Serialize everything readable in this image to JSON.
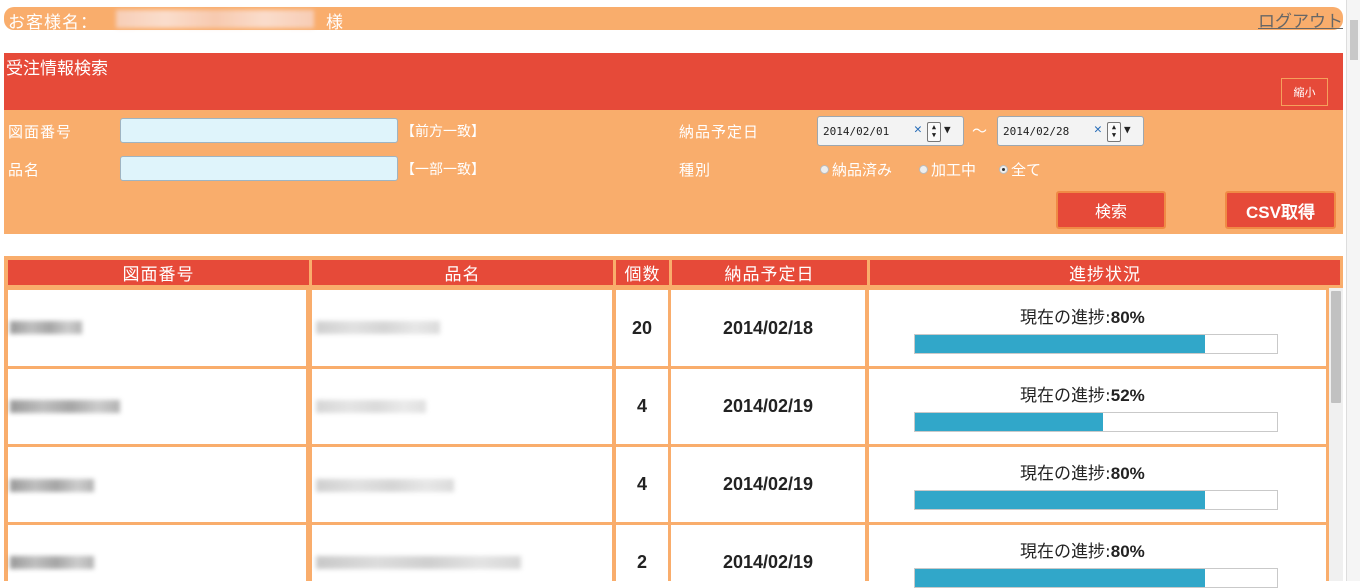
{
  "header": {
    "customer_label": "お客様名：",
    "honorific": "様",
    "logout": "ログアウト"
  },
  "search": {
    "title": "受注情報検索",
    "shrink": "縮小",
    "drawing_no_label": "図面番号",
    "drawing_no_hint": "【前方一致】",
    "product_label": "品名",
    "product_hint": "【一部一致】",
    "delivery_label": "納品予定日",
    "date_from": "2014/02/01",
    "date_sep": "～",
    "date_to": "2014/02/28",
    "type_label": "種別",
    "radios": [
      {
        "label": "納品済み",
        "checked": false
      },
      {
        "label": "加工中",
        "checked": false
      },
      {
        "label": "全て",
        "checked": true
      }
    ],
    "search_button": "検索",
    "csv_button": "CSV取得"
  },
  "table": {
    "headers": [
      "図面番号",
      "品名",
      "個数",
      "納品予定日",
      "進捗状況"
    ],
    "progress_prefix": "現在の進捗:",
    "rows": [
      {
        "qty": "20",
        "date": "2014/02/18",
        "progress": "80%",
        "progress_value": 0.8
      },
      {
        "qty": "4",
        "date": "2014/02/19",
        "progress": "52%",
        "progress_value": 0.52
      },
      {
        "qty": "4",
        "date": "2014/02/19",
        "progress": "80%",
        "progress_value": 0.8
      },
      {
        "qty": "2",
        "date": "2014/02/19",
        "progress": "80%",
        "progress_value": 0.8
      }
    ]
  },
  "colors": {
    "accent_red": "#e64a39",
    "accent_orange": "#f9ad6c",
    "progress_blue": "#31a7c9"
  }
}
